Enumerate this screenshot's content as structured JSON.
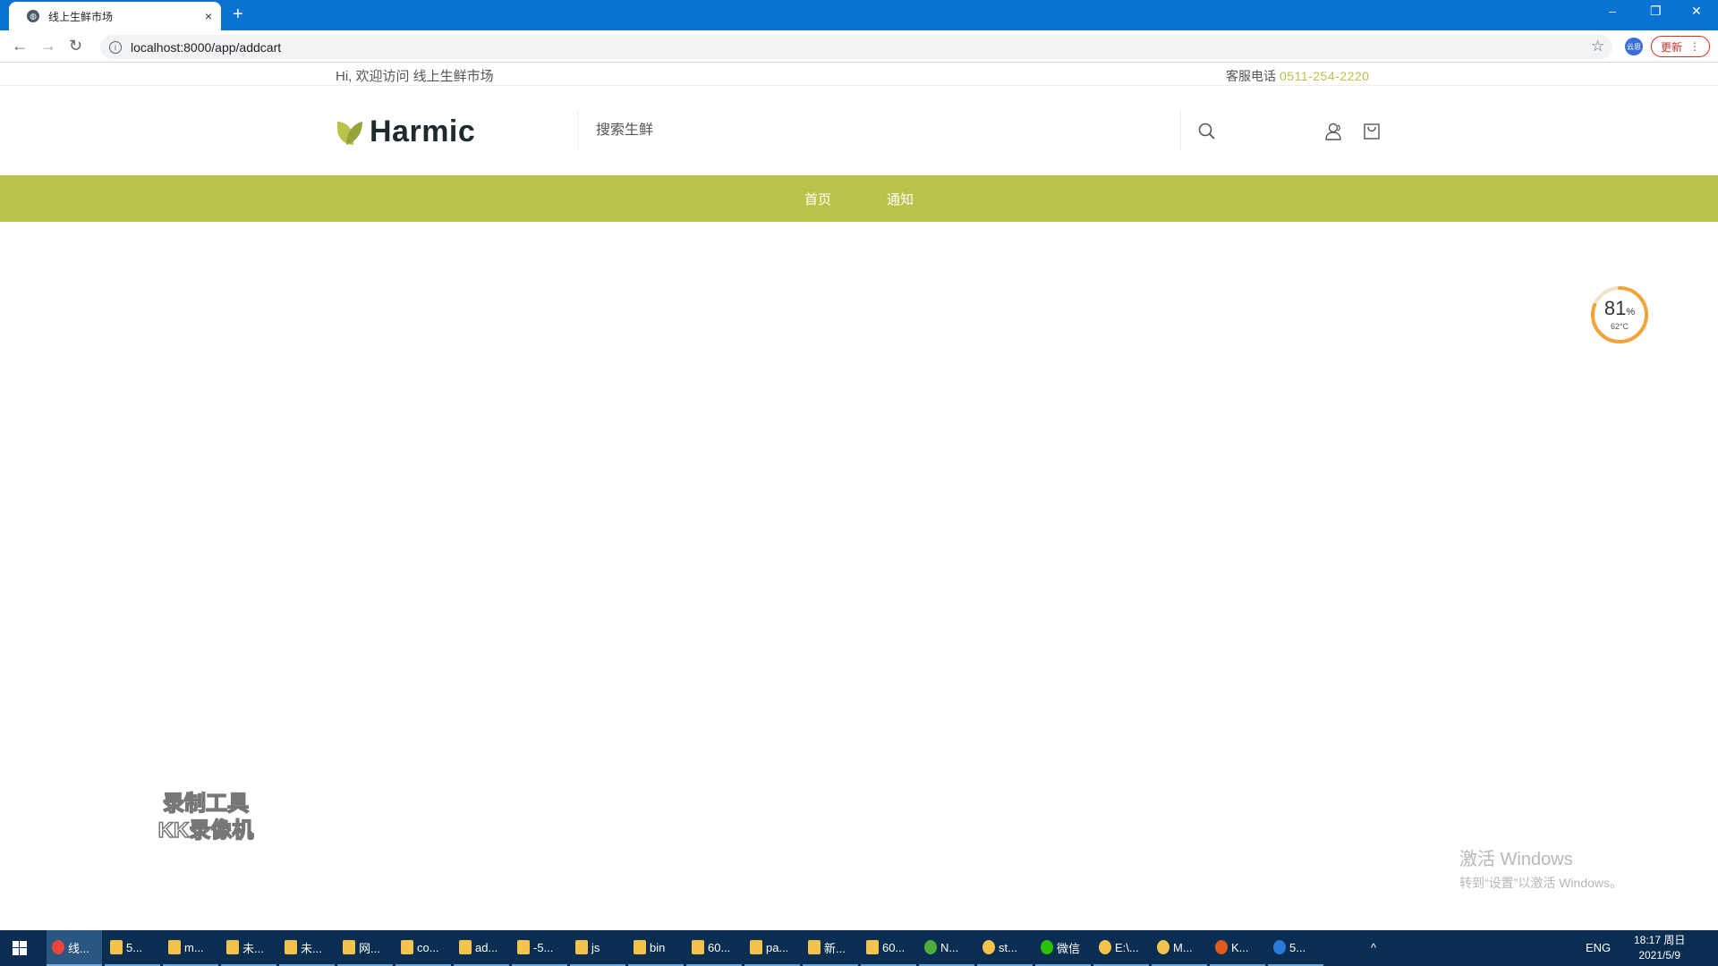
{
  "browser": {
    "tab_title": "线上生鲜市场",
    "tab_close": "×",
    "new_tab": "+",
    "url": "localhost:8000/app/addcart",
    "profile_label": "云思",
    "update_label": "更新",
    "update_menu": "⋮",
    "window": {
      "minimize": "–",
      "restore": "❐",
      "close": "✕"
    },
    "nav": {
      "back": "←",
      "forward": "→",
      "reload": "↻"
    },
    "info": "i",
    "star": "☆"
  },
  "site": {
    "welcome": "Hi, 欢迎访问 线上生鲜市场",
    "phone_label": "客服电话",
    "phone_number": "0511-254-2220",
    "logo_text": "Harmic",
    "search_placeholder": "搜索生鲜",
    "nav_items": [
      "首页",
      "通知"
    ],
    "accent_color": "#b9c34a"
  },
  "overlay": {
    "gauge_percent": 81,
    "gauge_value": "81",
    "gauge_unit": "%",
    "gauge_temp": "62°C",
    "recorder_line1": "录制工具",
    "recorder_line2": "KK录像机",
    "activate_title": "激活 Windows",
    "activate_sub": "转到“设置”以激活 Windows。"
  },
  "taskbar": {
    "items": [
      "线...",
      "5...",
      "m...",
      "未...",
      "未...",
      "网...",
      "co...",
      "ad...",
      "-5...",
      "js",
      "bin",
      "60...",
      "pa...",
      "新...",
      "60...",
      "N...",
      "st...",
      "微信",
      "E:\\...",
      "M...",
      "K...",
      "5..."
    ],
    "tray_chevron": "^",
    "lang": "ENG",
    "time": "18:17 周日",
    "date": "2021/5/9"
  }
}
